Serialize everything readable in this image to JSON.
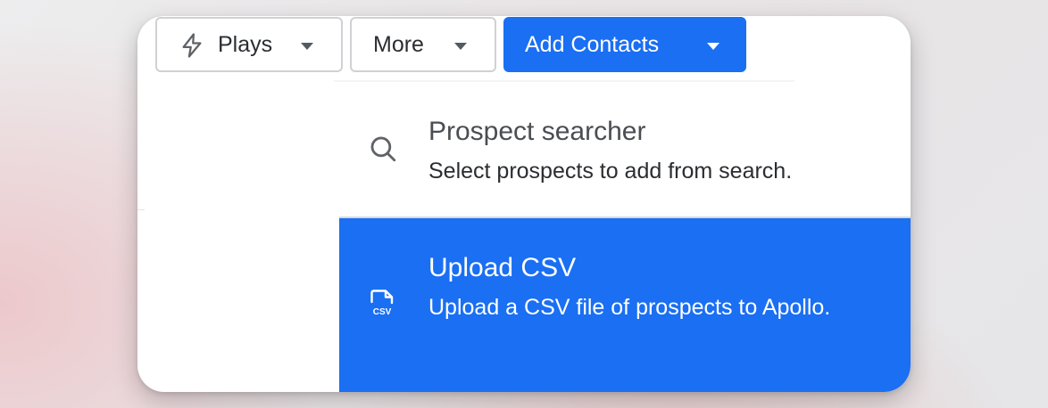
{
  "toolbar": {
    "plays": {
      "label": "Plays",
      "icon": "lightning-bolt-icon"
    },
    "more": {
      "label": "More"
    },
    "add_contacts": {
      "label": "Add Contacts"
    }
  },
  "add_contacts_menu": {
    "items": [
      {
        "title": "Prospect searcher",
        "description": "Select prospects to add from search.",
        "icon": "search-icon"
      },
      {
        "title": "Upload CSV",
        "description": "Upload a CSV file of prospects to Apollo.",
        "icon": "csv-file-icon",
        "icon_text": "CSV",
        "highlighted": true
      }
    ]
  },
  "colors": {
    "primary": "#1a6ff3",
    "text": "#2b2d31",
    "border": "#cfd1d4"
  }
}
